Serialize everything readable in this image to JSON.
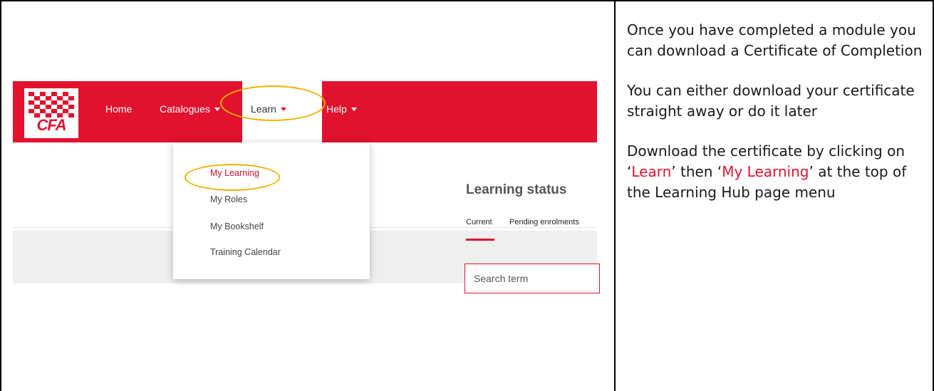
{
  "app": {
    "logo_text": "CFA"
  },
  "nav": {
    "items": [
      {
        "label": "Home"
      },
      {
        "label": "Catalogues"
      },
      {
        "label": "Learn"
      },
      {
        "label": "Help"
      }
    ]
  },
  "dropdown": {
    "items": [
      {
        "label": "My Learning"
      },
      {
        "label": "My Roles"
      },
      {
        "label": "My Bookshelf"
      },
      {
        "label": "Training Calendar"
      }
    ]
  },
  "main": {
    "status_title": "Learning status",
    "tabs": [
      {
        "label": "Current"
      },
      {
        "label": "Pending enrolments"
      }
    ],
    "search_placeholder": "Search term"
  },
  "instructions": {
    "p1": "Once you have completed a module you can download a Certificate of Completion",
    "p2": "You can either download your certificate straight away or do it later",
    "p3_part1": "Download the certificate by clicking on ‘",
    "p3_learn": "Learn",
    "p3_part2": "’ then ‘",
    "p3_mylearning": "My Learning",
    "p3_part3": "’ at the top of the Learning Hub page menu"
  },
  "colors": {
    "brand_red": "#e2122e",
    "highlight_yellow": "#f2b200"
  },
  "icons": {
    "logo": "cfa-checkered-logo",
    "dropdown_caret": "caret-down-icon"
  }
}
